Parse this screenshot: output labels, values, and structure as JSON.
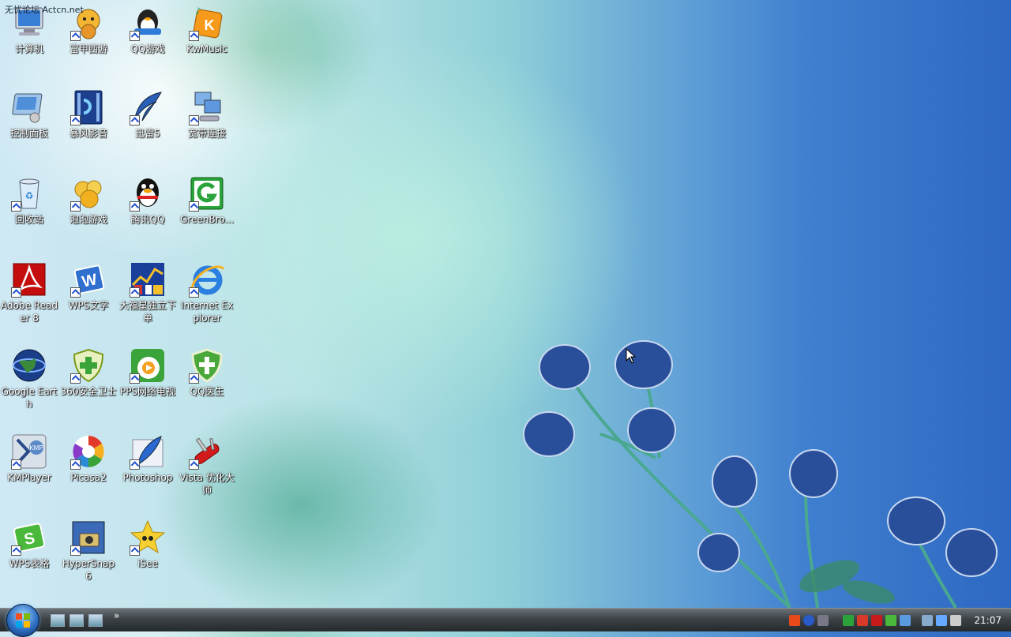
{
  "watermark": "无忧论坛 Actcn.net",
  "desktop": {
    "icons": [
      {
        "label": "计算机",
        "icon": "computer-icon"
      },
      {
        "label": "富甲西游",
        "icon": "game-mascot-icon"
      },
      {
        "label": "QQ游戏",
        "icon": "qq-game-icon"
      },
      {
        "label": "KwMusic",
        "icon": "kwmusic-icon"
      },
      {
        "label": "控制面板",
        "icon": "control-panel-icon"
      },
      {
        "label": "暴风影音",
        "icon": "baofeng-player-icon"
      },
      {
        "label": "迅雷5",
        "icon": "thunder-icon"
      },
      {
        "label": "宽带连接",
        "icon": "network-connection-icon"
      },
      {
        "label": "回收站",
        "icon": "recycle-bin-icon"
      },
      {
        "label": "泡泡游戏",
        "icon": "paopao-game-icon"
      },
      {
        "label": "腾讯QQ",
        "icon": "qq-penguin-icon"
      },
      {
        "label": "GreenBro...",
        "icon": "greenbrowser-icon"
      },
      {
        "label": "Adobe Reader 8",
        "icon": "adobe-reader-icon"
      },
      {
        "label": "WPS文字",
        "icon": "wps-writer-icon"
      },
      {
        "label": "大福星独立下单",
        "icon": "trading-tics-icon"
      },
      {
        "label": "Internet Explorer",
        "icon": "internet-explorer-icon"
      },
      {
        "label": "Google Earth",
        "icon": "google-earth-icon"
      },
      {
        "label": "360安全卫士",
        "icon": "security-360-icon"
      },
      {
        "label": "PPS网络电视",
        "icon": "pps-tv-icon"
      },
      {
        "label": "QQ医生",
        "icon": "qq-doctor-icon"
      },
      {
        "label": "KMPlayer",
        "icon": "kmplayer-icon"
      },
      {
        "label": "Picasa2",
        "icon": "picasa-icon"
      },
      {
        "label": "Photoshop",
        "icon": "photoshop-feather-icon"
      },
      {
        "label": "Vista 优化大师",
        "icon": "swiss-knife-icon"
      },
      {
        "label": "WPS表格",
        "icon": "wps-spreadsheet-icon"
      },
      {
        "label": "HyperSnap 6",
        "icon": "hypersnap-icon"
      },
      {
        "label": "iSee",
        "icon": "isee-star-icon"
      }
    ]
  },
  "taskbar": {
    "more_glyph": "»",
    "clock": "21:07"
  },
  "colors": {
    "taskbar": "#3c4246",
    "start_orb": "#2d6fc2"
  }
}
